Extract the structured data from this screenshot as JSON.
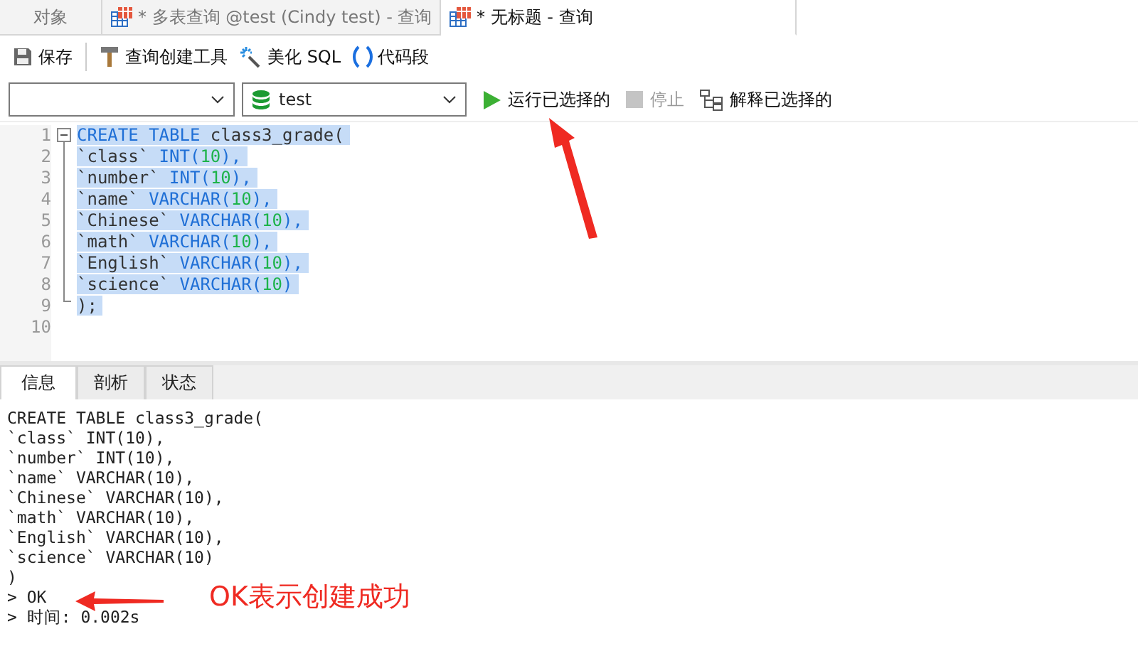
{
  "tabs": [
    {
      "label": "对象",
      "kind": "objects",
      "selected": false
    },
    {
      "label": "* 多表查询 @test (Cindy test) - 查询",
      "kind": "query",
      "selected": false
    },
    {
      "label": "* 无标题 - 查询",
      "kind": "query",
      "selected": true
    }
  ],
  "toolbar": [
    {
      "kind": "save",
      "label": "保存"
    },
    {
      "kind": "builder",
      "label": "查询创建工具"
    },
    {
      "kind": "beautify",
      "label": "美化 SQL"
    },
    {
      "kind": "snippet",
      "label": "代码段"
    }
  ],
  "query_bar": {
    "database": {
      "value": "test"
    },
    "actions": [
      {
        "kind": "run",
        "label": "运行已选择的",
        "disabled": false
      },
      {
        "kind": "stop",
        "label": "停止",
        "disabled": true
      },
      {
        "kind": "explain",
        "label": "解释已选择的",
        "disabled": false
      }
    ]
  },
  "editor": {
    "lines": [
      {
        "number": "1",
        "selected": true,
        "tokens": [
          {
            "text": "CREATE TABLE ",
            "kind": "keyword"
          },
          {
            "text": "class3_grade(",
            "kind": "plain"
          }
        ]
      },
      {
        "number": "2",
        "selected": true,
        "tokens": [
          {
            "text": "`class` ",
            "kind": "plain"
          },
          {
            "text": "INT(",
            "kind": "keyword"
          },
          {
            "text": "10",
            "kind": "number"
          },
          {
            "text": "),",
            "kind": "keyword"
          }
        ]
      },
      {
        "number": "3",
        "selected": true,
        "tokens": [
          {
            "text": "`number` ",
            "kind": "plain"
          },
          {
            "text": "INT(",
            "kind": "keyword"
          },
          {
            "text": "10",
            "kind": "number"
          },
          {
            "text": "),",
            "kind": "keyword"
          }
        ]
      },
      {
        "number": "4",
        "selected": true,
        "tokens": [
          {
            "text": "`name` ",
            "kind": "plain"
          },
          {
            "text": "VARCHAR(",
            "kind": "keyword"
          },
          {
            "text": "10",
            "kind": "number"
          },
          {
            "text": "),",
            "kind": "keyword"
          }
        ]
      },
      {
        "number": "5",
        "selected": true,
        "tokens": [
          {
            "text": "`Chinese` ",
            "kind": "plain"
          },
          {
            "text": "VARCHAR(",
            "kind": "keyword"
          },
          {
            "text": "10",
            "kind": "number"
          },
          {
            "text": "),",
            "kind": "keyword"
          }
        ]
      },
      {
        "number": "6",
        "selected": true,
        "tokens": [
          {
            "text": "`math` ",
            "kind": "plain"
          },
          {
            "text": "VARCHAR(",
            "kind": "keyword"
          },
          {
            "text": "10",
            "kind": "number"
          },
          {
            "text": "),",
            "kind": "keyword"
          }
        ]
      },
      {
        "number": "7",
        "selected": true,
        "tokens": [
          {
            "text": "`English` ",
            "kind": "plain"
          },
          {
            "text": "VARCHAR(",
            "kind": "keyword"
          },
          {
            "text": "10",
            "kind": "number"
          },
          {
            "text": "),",
            "kind": "keyword"
          }
        ]
      },
      {
        "number": "8",
        "selected": true,
        "tokens": [
          {
            "text": "`science` ",
            "kind": "plain"
          },
          {
            "text": "VARCHAR(",
            "kind": "keyword"
          },
          {
            "text": "10",
            "kind": "number"
          },
          {
            "text": ")",
            "kind": "keyword"
          }
        ]
      },
      {
        "number": "9",
        "selected": true,
        "tokens": [
          {
            "text": ");",
            "kind": "plain"
          }
        ]
      },
      {
        "number": "10"
      }
    ]
  },
  "result_tabs": [
    {
      "label": "信息",
      "selected": true
    },
    {
      "label": "剖析",
      "selected": false
    },
    {
      "label": "状态",
      "selected": false
    }
  ],
  "messages": [
    "CREATE TABLE class3_grade(",
    "`class` INT(10),",
    "`number` INT(10),",
    "`name` VARCHAR(10),",
    "`Chinese` VARCHAR(10),",
    "`math` VARCHAR(10),",
    "`English` VARCHAR(10),",
    "`science` VARCHAR(10)",
    ")",
    "> OK",
    "> 时间: 0.002s"
  ],
  "annotation": {
    "text": "OK表示创建成功"
  }
}
